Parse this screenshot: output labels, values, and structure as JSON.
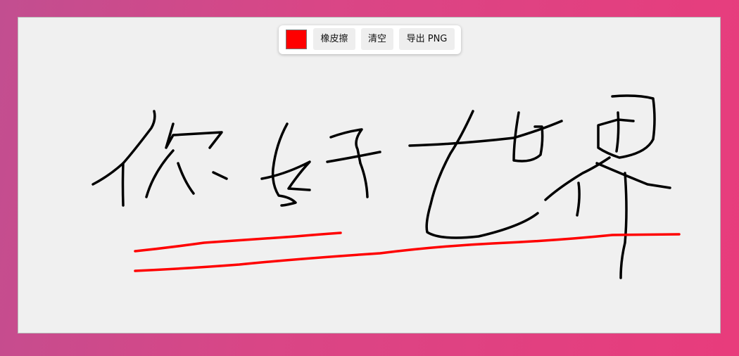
{
  "toolbar": {
    "color": "#ff0000",
    "eraser_label": "橡皮擦",
    "clear_label": "清空",
    "export_label": "导出 PNG"
  },
  "canvas": {
    "background": "#f0f0f0",
    "handwriting_text": "你好世界",
    "ink_colors": [
      "#000000",
      "#ff0000"
    ]
  }
}
